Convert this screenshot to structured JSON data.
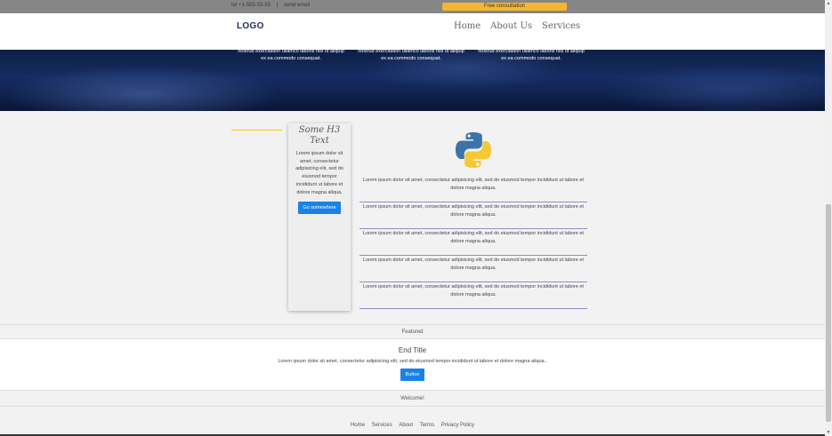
{
  "topbar": {
    "phone": "tel +1-555-55-55",
    "separator": "|",
    "email": "send email",
    "cta": "Free consultation"
  },
  "header": {
    "logo": "LOGO",
    "nav": [
      "Home",
      "About Us",
      "Services"
    ]
  },
  "hero": {
    "columns": [
      "nostrud exercitation ullamco laboris nisi ut aliquip ex ea commodo consequat.",
      "nostrud exercitation ullamco laboris nisi ut aliquip ex ea commodo consequat.",
      "nostrud exercitation ullamco laboris nisi ut aliquip ex ea commodo consequat."
    ]
  },
  "card": {
    "title": "Some H3 Text",
    "body": "Lorem ipsum dolor sit amet, consectetur adipisicing elit, sed do eiusmod tempor incididunt ut labore et dolore magna aliqua.",
    "button": "Go somewhere"
  },
  "rows": [
    "Lorem ipsum dolor sit amet, consectetur adipisicing elit, sed do eiusmod tempor incididunt ut labore et dolore magna aliqua.",
    "Lorem ipsum dolor sit amet, consectetur adipisicing elit, sed do eiusmod tempor incididunt ut labore et dolore magna aliqua.",
    "Lorem ipsum dolor sit amet, consectetur adipisicing elit, sed do eiusmod tempor incididunt ut labore et dolore magna aliqua.",
    "Lorem ipsum dolor sit amet, consectetur adipisicing elit, sed do eiusmod tempor incididunt ut labore et dolore magna aliqua.",
    "Lorem ipsum dolor sit amet, consectetur adipisicing elit, sed do eiusmod tempor incididunt ut labore et dolore magna aliqua."
  ],
  "featured": "Featured",
  "end": {
    "title": "End Title",
    "text": "Lorem ipsum dolor sit amet, consectetur adipisicing elit, sed do eiusmod tempor incididunt ut labore et dolore magna aliqua..",
    "button": "Button"
  },
  "welcome": "Welcome!",
  "footer": {
    "links": [
      "Home",
      "Services",
      "About",
      "Terms",
      "Privacy Policy"
    ]
  },
  "colors": {
    "accent_yellow": "#f5b731",
    "button_blue": "#1a82e6",
    "hero_navy": "#162d63",
    "row_divider": "#8b8fc8"
  },
  "icons": [
    "python-logo-icon",
    "scroll-up-arrow-icon",
    "scroll-down-arrow-icon"
  ]
}
